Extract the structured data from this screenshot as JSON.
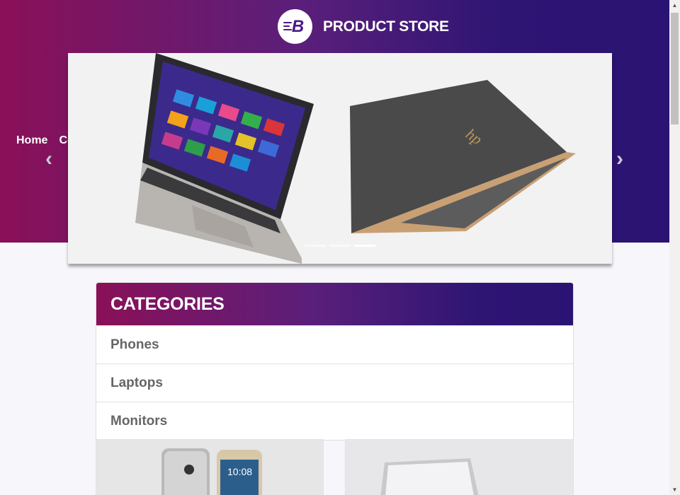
{
  "header": {
    "brand_name": "PRODUCT STORE",
    "logo_letter": "B"
  },
  "nav": {
    "items": [
      {
        "label": "Home"
      },
      {
        "label": "Co"
      }
    ]
  },
  "carousel": {
    "prev_icon": "‹",
    "next_icon": "›",
    "slide_count": 3,
    "active_index": 2
  },
  "categories": {
    "title": "CATEGORIES",
    "items": [
      {
        "label": "Phones"
      },
      {
        "label": "Laptops"
      },
      {
        "label": "Monitors"
      }
    ]
  },
  "product_cards": [
    {
      "image_icon": "phone-product-image"
    },
    {
      "image_icon": "laptop-product-image"
    }
  ],
  "theme": {
    "gradient_start": "#8a1058",
    "gradient_end": "#2a1372"
  }
}
